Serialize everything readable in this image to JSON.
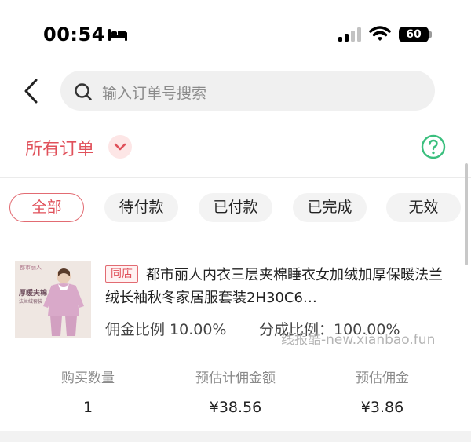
{
  "status_bar": {
    "time": "00:54",
    "battery": "60"
  },
  "search": {
    "placeholder": "输入订单号搜索"
  },
  "filter": {
    "title": "所有订单",
    "accent_color": "#e0505a",
    "help_color": "#3bbf7e"
  },
  "tabs": [
    {
      "label": "全部",
      "active": true
    },
    {
      "label": "待付款",
      "active": false
    },
    {
      "label": "已付款",
      "active": false
    },
    {
      "label": "已完成",
      "active": false
    },
    {
      "label": "无效",
      "active": false
    }
  ],
  "order": {
    "badge": "同店",
    "title": "都市丽人内衣三层夹棉睡衣女加绒加厚保暖法兰绒长袖秋冬家居服套装2H30C6…",
    "image_text": {
      "brand": "都市丽人",
      "line1": "厚暖夹棉",
      "line2": "法兰绒套装"
    },
    "commission_rate": "佣金比例 10.00%",
    "share_rate": "分成比例：100.00%",
    "stats": [
      {
        "label": "购买数量",
        "value": "1"
      },
      {
        "label": "预估计佣金额",
        "value": "¥38.56"
      },
      {
        "label": "预估佣金",
        "value": "¥3.86"
      }
    ]
  },
  "watermark": "线报酷-new.xianbao.fun"
}
